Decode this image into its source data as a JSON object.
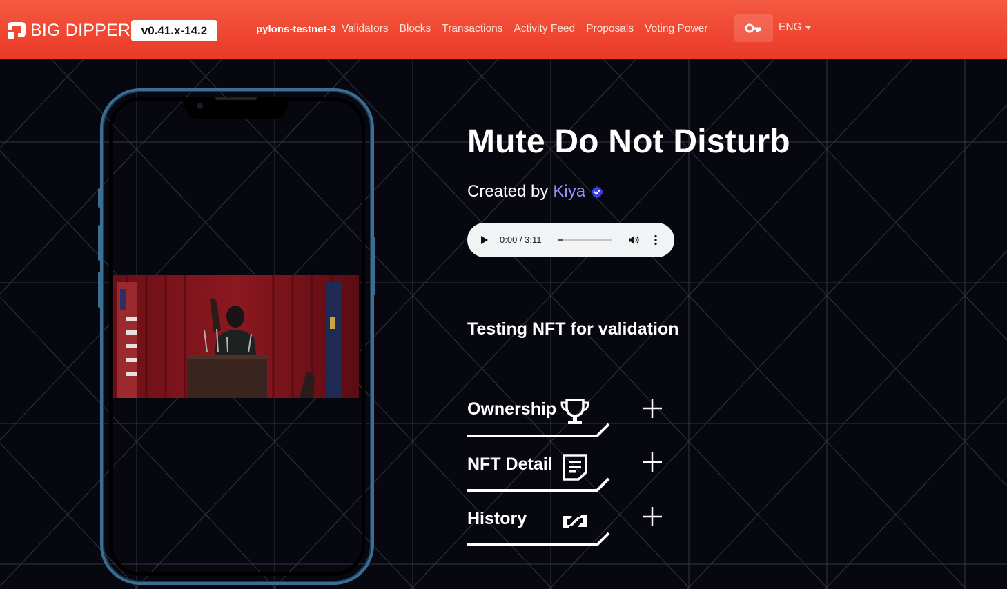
{
  "navbar": {
    "brand_name": "BIG DIPPER",
    "version": "v0.41.x-14.2",
    "chain_id": "pylons-testnet-3",
    "links": [
      {
        "label": "Validators"
      },
      {
        "label": "Blocks"
      },
      {
        "label": "Transactions"
      },
      {
        "label": "Activity Feed"
      },
      {
        "label": "Proposals"
      },
      {
        "label": "Voting Power"
      }
    ],
    "key_icon": "key-icon",
    "language": "ENG"
  },
  "nft": {
    "title": "Mute Do Not Disturb",
    "created_by_label": "Created by",
    "creator": "Kiya",
    "verified_icon": "verified-badge-icon",
    "audio": {
      "time": "0:00 / 3:11",
      "progress": 0
    },
    "description": "Testing NFT for validation"
  },
  "sections": [
    {
      "label": "Ownership",
      "icon": "trophy-icon",
      "toggle": "+"
    },
    {
      "label": "NFT Detail",
      "icon": "document-icon",
      "toggle": "+"
    },
    {
      "label": "History",
      "icon": "history-icon",
      "toggle": "+"
    }
  ],
  "colors": {
    "navbar": "#f04732",
    "background": "#07070f",
    "creator_link": "#9d8cff",
    "phone_frame": "#3c6d92"
  }
}
